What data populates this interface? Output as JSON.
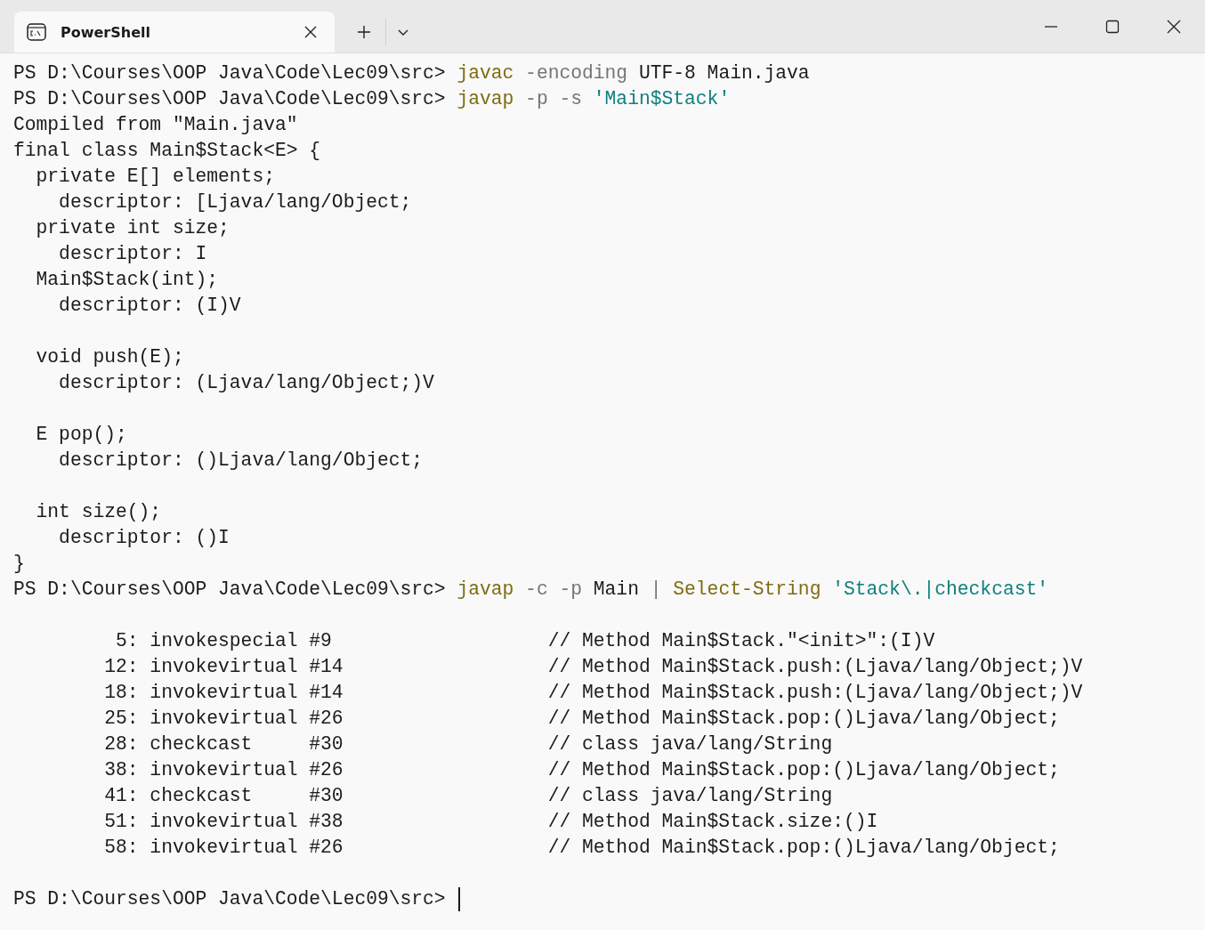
{
  "tabs": [
    {
      "title": "PowerShell",
      "selected": true
    }
  ],
  "lines": [
    {
      "kind": "text",
      "segments": [
        {
          "kind": "prompt",
          "text": "PS D:\\Courses\\OOP Java\\Code\\Lec09\\src> "
        },
        {
          "kind": "command",
          "text": "javac"
        },
        {
          "kind": "parameter",
          "text": " -encoding"
        },
        {
          "kind": "output",
          "text": " UTF-8 Main.java"
        }
      ]
    },
    {
      "kind": "text",
      "segments": [
        {
          "kind": "prompt",
          "text": "PS D:\\Courses\\OOP Java\\Code\\Lec09\\src> "
        },
        {
          "kind": "command",
          "text": "javap"
        },
        {
          "kind": "parameter",
          "text": " -p -s"
        },
        {
          "kind": "string",
          "text": " 'Main$Stack'"
        }
      ]
    },
    {
      "kind": "text",
      "segments": [
        {
          "kind": "output",
          "text": "Compiled from \"Main.java\""
        }
      ]
    },
    {
      "kind": "text",
      "segments": [
        {
          "kind": "output",
          "text": "final class Main$Stack<E> {"
        }
      ]
    },
    {
      "kind": "text",
      "segments": [
        {
          "kind": "output",
          "text": "  private E[] elements;"
        }
      ]
    },
    {
      "kind": "text",
      "segments": [
        {
          "kind": "output",
          "text": "    descriptor: [Ljava/lang/Object;"
        }
      ]
    },
    {
      "kind": "text",
      "segments": [
        {
          "kind": "output",
          "text": "  private int size;"
        }
      ]
    },
    {
      "kind": "text",
      "segments": [
        {
          "kind": "output",
          "text": "    descriptor: I"
        }
      ]
    },
    {
      "kind": "text",
      "segments": [
        {
          "kind": "output",
          "text": "  Main$Stack(int);"
        }
      ]
    },
    {
      "kind": "text",
      "segments": [
        {
          "kind": "output",
          "text": "    descriptor: (I)V"
        }
      ]
    },
    {
      "kind": "blank"
    },
    {
      "kind": "text",
      "segments": [
        {
          "kind": "output",
          "text": "  void push(E);"
        }
      ]
    },
    {
      "kind": "text",
      "segments": [
        {
          "kind": "output",
          "text": "    descriptor: (Ljava/lang/Object;)V"
        }
      ]
    },
    {
      "kind": "blank"
    },
    {
      "kind": "text",
      "segments": [
        {
          "kind": "output",
          "text": "  E pop();"
        }
      ]
    },
    {
      "kind": "text",
      "segments": [
        {
          "kind": "output",
          "text": "    descriptor: ()Ljava/lang/Object;"
        }
      ]
    },
    {
      "kind": "blank"
    },
    {
      "kind": "text",
      "segments": [
        {
          "kind": "output",
          "text": "  int size();"
        }
      ]
    },
    {
      "kind": "text",
      "segments": [
        {
          "kind": "output",
          "text": "    descriptor: ()I"
        }
      ]
    },
    {
      "kind": "text",
      "segments": [
        {
          "kind": "output",
          "text": "}"
        }
      ]
    },
    {
      "kind": "text",
      "segments": [
        {
          "kind": "prompt",
          "text": "PS D:\\Courses\\OOP Java\\Code\\Lec09\\src> "
        },
        {
          "kind": "command",
          "text": "javap"
        },
        {
          "kind": "parameter",
          "text": " -c -p"
        },
        {
          "kind": "output",
          "text": " Main"
        },
        {
          "kind": "operator",
          "text": " |"
        },
        {
          "kind": "command",
          "text": " Select-String"
        },
        {
          "kind": "string",
          "text": " 'Stack\\.|checkcast'"
        }
      ]
    },
    {
      "kind": "blank"
    },
    {
      "kind": "text",
      "segments": [
        {
          "kind": "output",
          "text": "         5: invokespecial #9                   // Method Main$Stack.\"<init>\":(I)V"
        }
      ]
    },
    {
      "kind": "text",
      "segments": [
        {
          "kind": "output",
          "text": "        12: invokevirtual #14                  // Method Main$Stack.push:(Ljava/lang/Object;)V"
        }
      ]
    },
    {
      "kind": "text",
      "segments": [
        {
          "kind": "output",
          "text": "        18: invokevirtual #14                  // Method Main$Stack.push:(Ljava/lang/Object;)V"
        }
      ]
    },
    {
      "kind": "text",
      "segments": [
        {
          "kind": "output",
          "text": "        25: invokevirtual #26                  // Method Main$Stack.pop:()Ljava/lang/Object;"
        }
      ]
    },
    {
      "kind": "text",
      "segments": [
        {
          "kind": "output",
          "text": "        28: checkcast     #30                  // class java/lang/String"
        }
      ]
    },
    {
      "kind": "text",
      "segments": [
        {
          "kind": "output",
          "text": "        38: invokevirtual #26                  // Method Main$Stack.pop:()Ljava/lang/Object;"
        }
      ]
    },
    {
      "kind": "text",
      "segments": [
        {
          "kind": "output",
          "text": "        41: checkcast     #30                  // class java/lang/String"
        }
      ]
    },
    {
      "kind": "text",
      "segments": [
        {
          "kind": "output",
          "text": "        51: invokevirtual #38                  // Method Main$Stack.size:()I"
        }
      ]
    },
    {
      "kind": "text",
      "segments": [
        {
          "kind": "output",
          "text": "        58: invokevirtual #26                  // Method Main$Stack.pop:()Ljava/lang/Object;"
        }
      ]
    },
    {
      "kind": "blank"
    },
    {
      "kind": "text",
      "segments": [
        {
          "kind": "prompt",
          "text": "PS D:\\Courses\\OOP Java\\Code\\Lec09\\src> "
        }
      ],
      "cursor": true
    }
  ]
}
